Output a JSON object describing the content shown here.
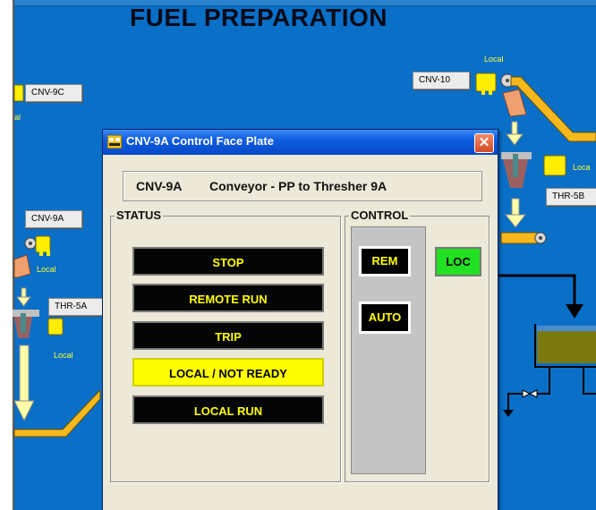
{
  "screen": {
    "title": "FUEL PREPARATION",
    "tags": {
      "cnv9c": "CNV-9C",
      "cnv10": "CNV-10",
      "cnv9a": "CNV-9A",
      "thr5a": "THR-5A",
      "thr5b": "THR-5B"
    },
    "local_label": "Local",
    "partial_local": "al",
    "partial_local_right": "Loca"
  },
  "dialog": {
    "title": "CNV-9A Control Face Plate",
    "close_symbol": "✕",
    "equipment_id": "CNV-9A",
    "equipment_desc": "Conveyor - PP to Thresher 9A",
    "status": {
      "label": "STATUS",
      "buttons": [
        {
          "label": "STOP",
          "active": false
        },
        {
          "label": "REMOTE RUN",
          "active": false
        },
        {
          "label": "TRIP",
          "active": false
        },
        {
          "label": "LOCAL / NOT READY",
          "active": true
        },
        {
          "label": "LOCAL RUN",
          "active": false
        }
      ]
    },
    "control": {
      "label": "CONTROL",
      "rem": "REM",
      "auto": "AUTO",
      "loc": "LOC"
    }
  },
  "colors": {
    "background": "#0a6fc7",
    "conveyor": "#f6b81c",
    "status_text": "#ffff00",
    "active_status": "#ffff00",
    "loc_active": "#22e022",
    "tank_liquid": "#7a7a10"
  }
}
